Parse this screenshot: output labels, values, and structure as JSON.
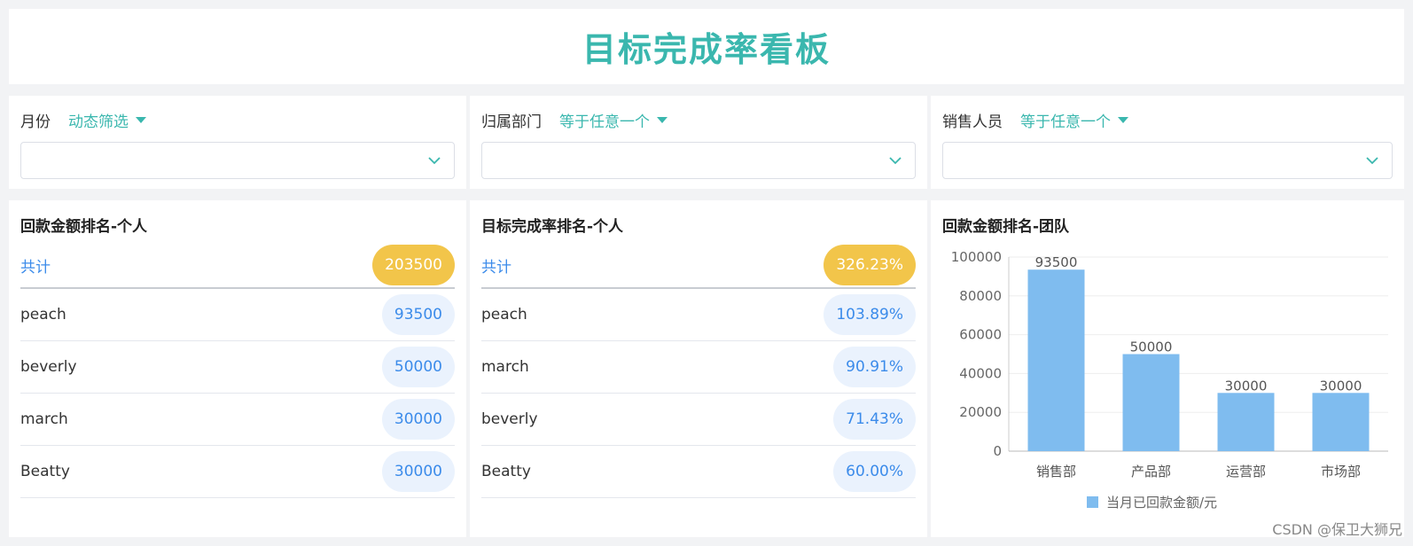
{
  "title": "目标完成率看板",
  "filters": [
    {
      "label": "月份",
      "mode": "动态筛选"
    },
    {
      "label": "归属部门",
      "mode": "等于任意一个"
    },
    {
      "label": "销售人员",
      "mode": "等于任意一个"
    }
  ],
  "panel_amount": {
    "title": "回款金额排名-个人",
    "total_label": "共计",
    "total_value": "203500",
    "rows": [
      {
        "name": "peach",
        "value": "93500"
      },
      {
        "name": "beverly",
        "value": "50000"
      },
      {
        "name": "march",
        "value": "30000"
      },
      {
        "name": "Beatty",
        "value": "30000"
      }
    ]
  },
  "panel_rate": {
    "title": "目标完成率排名-个人",
    "total_label": "共计",
    "total_value": "326.23%",
    "rows": [
      {
        "name": "peach",
        "value": "103.89%"
      },
      {
        "name": "march",
        "value": "90.91%"
      },
      {
        "name": "beverly",
        "value": "71.43%"
      },
      {
        "name": "Beatty",
        "value": "60.00%"
      }
    ]
  },
  "panel_team": {
    "title": "回款金额排名-团队"
  },
  "chart_data": {
    "type": "bar",
    "categories": [
      "销售部",
      "产品部",
      "运营部",
      "市场部"
    ],
    "series": [
      {
        "name": "当月已回款金额/元",
        "values": [
          93500,
          50000,
          30000,
          30000
        ]
      }
    ],
    "ylim": [
      0,
      100000
    ],
    "yticks": [
      0,
      20000,
      40000,
      60000,
      80000,
      100000
    ],
    "grid": true,
    "legend": "bottom",
    "bar_color": "#7fbcef"
  },
  "watermark": "CSDN @保卫大狮兄"
}
